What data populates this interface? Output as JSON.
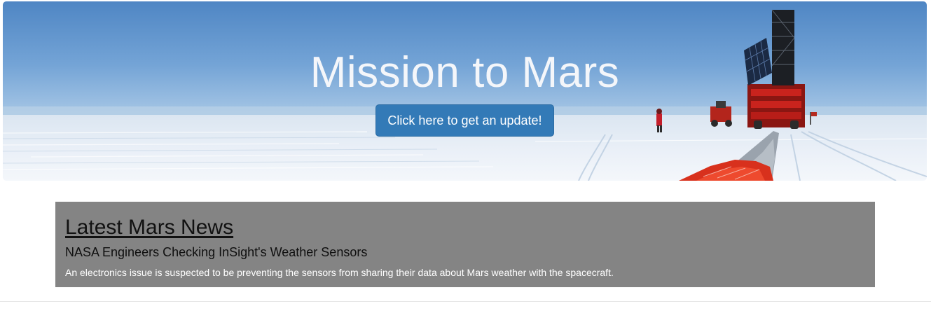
{
  "hero": {
    "title": "Mission to Mars",
    "button_label": "Click here to get an update!",
    "image": "antarctic-ice-field-with-research-tower",
    "colors": {
      "button": "#337ab7",
      "title": "#f4f6fa"
    }
  },
  "news": {
    "heading": "Latest Mars News",
    "title": "NASA Engineers Checking InSight's Weather Sensors",
    "teaser": "An electronics issue is suspected to be preventing the sensors from sharing their data about Mars weather with the spacecraft.",
    "background": "#848484"
  }
}
